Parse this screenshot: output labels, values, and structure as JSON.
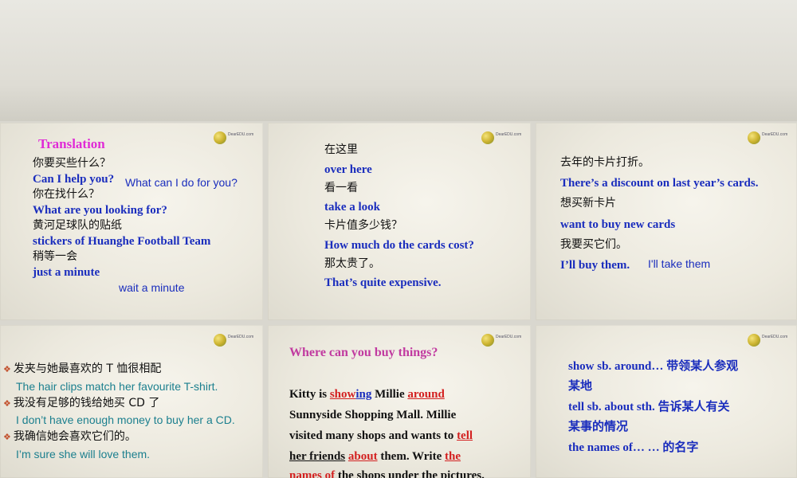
{
  "logo_text": "DearEDU.com",
  "s1": {
    "title": "Translation",
    "l1": "你要买些什么？",
    "l2": "Can I help you?",
    "l2_alt": "What can I do for you?",
    "l3": "你在找什么？",
    "l4": "What are you looking for?",
    "l5": "黄河足球队的贴纸",
    "l6": "stickers of Huanghe Football Team",
    "l7": "稍等一会",
    "l8": "just a minute",
    "l8_alt": "wait a minute"
  },
  "s2": {
    "l1": "在这里",
    "l2": "over here",
    "l3": "看一看",
    "l4": "take a look",
    "l5": "卡片值多少钱？",
    "l6": "How much do the cards cost?",
    "l7": "那太贵了。",
    "l8": "That’s quite expensive."
  },
  "s3": {
    "l1": "去年的卡片打折。",
    "l2": "There’s a discount on last year’s cards.",
    "l3": "想买新卡片",
    "l4": "want to buy new cards",
    "l5": "我要买它们。",
    "l6": "I’ll buy them.",
    "l6_alt": "I'll take them"
  },
  "s4": {
    "l1": "发夹与她最喜欢的 T 恤很相配",
    "l2": "The hair clips match her favourite T-shirt.",
    "l3": "我没有足够的钱给她买 CD 了",
    "l4": "I don’t have enough money to buy her a CD.",
    "l5": "我确信她会喜欢它们的。",
    "l6": "I’m sure she will love them."
  },
  "s5": {
    "title": "Where can you buy things?",
    "p1a": "Kitty is ",
    "p1b": "show",
    "p1c": "ing",
    "p1d": " Millie ",
    "p1e": "around",
    "p2": "Sunnyside Shopping Mall. Millie",
    "p3a": "visited many shops and wants to ",
    "p3b": "tell",
    "p4a": "her friends",
    "p4b": " ",
    "p4c": "about",
    "p4d": " them. Write ",
    "p4e": "the",
    "p5a": "names of",
    "p5b": " the shops under the pictures."
  },
  "s6": {
    "l1": "show sb. around… 带领某人参观",
    "l2": "某地",
    "l3": "tell sb. about sth.  告诉某人有关",
    "l4": "某事的情况",
    "l5": "the names of… … 的名字"
  }
}
